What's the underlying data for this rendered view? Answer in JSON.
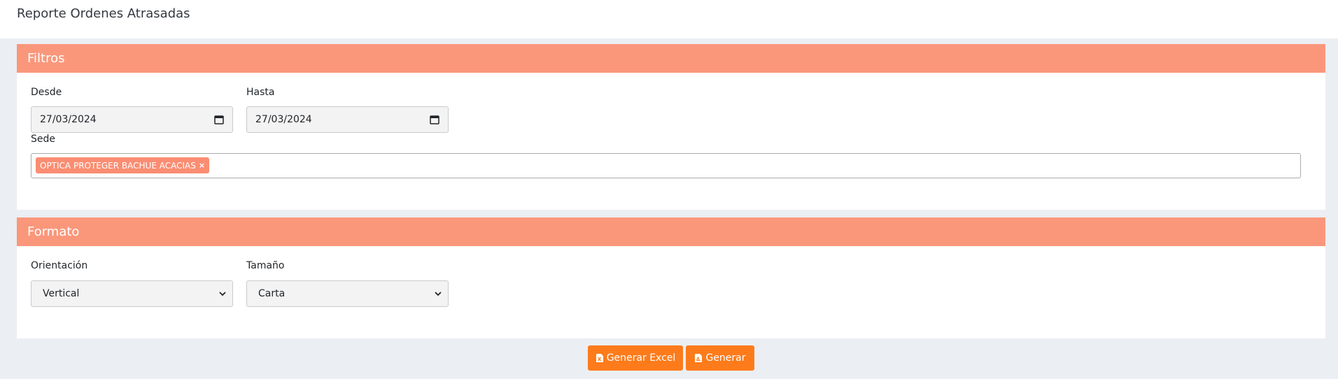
{
  "header": {
    "title": "Reporte Ordenes Atrasadas"
  },
  "filters": {
    "title": "Filtros",
    "desde_label": "Desde",
    "desde_value": "27/03/2024",
    "hasta_label": "Hasta",
    "hasta_value": "27/03/2024",
    "sede_label": "Sede",
    "sede_selected": [
      "OPTICA PROTEGER BACHUE ACACIAS"
    ],
    "chip_remove": "×"
  },
  "format": {
    "title": "Formato",
    "orientation_label": "Orientación",
    "orientation_value": "Vertical",
    "size_label": "Tamaño",
    "size_value": "Carta"
  },
  "actions": {
    "excel_label": "Generar Excel",
    "generate_label": "Generar"
  },
  "colors": {
    "header_accent": "#fa977b",
    "chip": "#fa8d72",
    "button": "#fd7b1b"
  },
  "icons": {
    "calendar": "calendar-icon",
    "chevron": "chevron-down-icon",
    "excel": "file-excel-icon",
    "pdf": "file-pdf-icon"
  }
}
